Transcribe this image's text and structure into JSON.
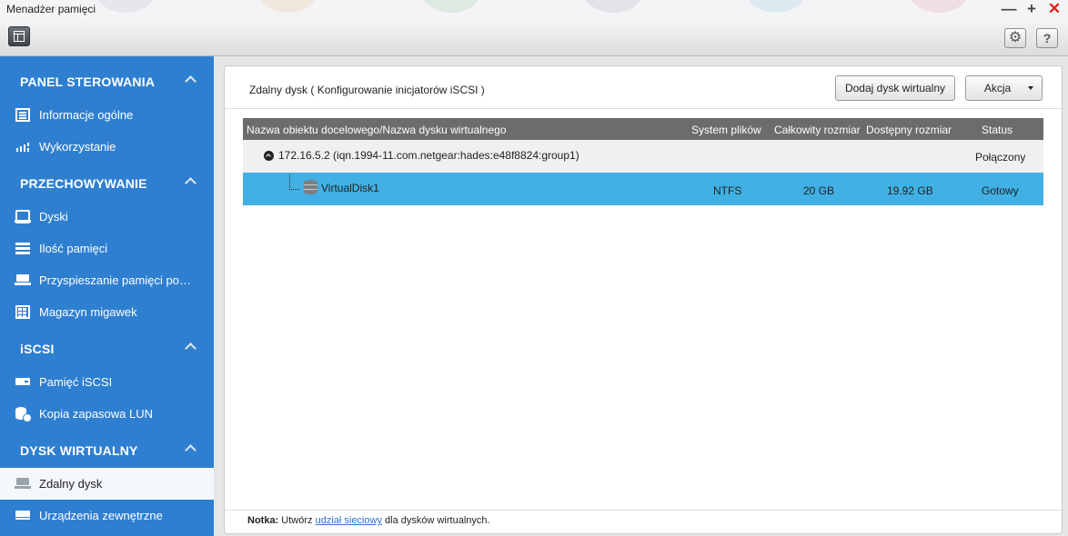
{
  "window": {
    "title": "Menadżer pamięci",
    "controls": {
      "minimize": "—",
      "maximize": "+",
      "close": "✕"
    }
  },
  "toolbar": {
    "layout_icon": "layout-icon",
    "settings_icon": "gear-icon",
    "help_label": "?"
  },
  "sidebar": {
    "sections": [
      {
        "title": "PANEL STEROWANIA",
        "items": [
          {
            "label": "Informacje ogólne",
            "icon": "info-list-icon"
          },
          {
            "label": "Wykorzystanie",
            "icon": "usage-bars-icon"
          }
        ]
      },
      {
        "title": "PRZECHOWYWANIE",
        "items": [
          {
            "label": "Dyski",
            "icon": "disk-icon"
          },
          {
            "label": "Ilość pamięci",
            "icon": "storage-stack-icon"
          },
          {
            "label": "Przyspieszanie pamięci podr…",
            "icon": "cache-drive-icon"
          },
          {
            "label": "Magazyn migawek",
            "icon": "snapshot-icon"
          }
        ]
      },
      {
        "title": "iSCSI",
        "items": [
          {
            "label": "Pamięć iSCSI",
            "icon": "iscsi-drive-icon"
          },
          {
            "label": "Kopia zapasowa LUN",
            "icon": "lun-backup-icon"
          }
        ]
      },
      {
        "title": "DYSK WIRTUALNY",
        "items": [
          {
            "label": "Zdalny dysk",
            "icon": "remote-disk-icon",
            "active": true
          },
          {
            "label": "Urządzenia zewnętrzne",
            "icon": "external-device-icon"
          }
        ]
      }
    ]
  },
  "main": {
    "title": "Zdalny dysk ( Konfigurowanie inicjatorów iSCSI )",
    "buttons": {
      "add_virtual_disk": "Dodaj dysk wirtualny",
      "action": "Akcja"
    },
    "table": {
      "columns": [
        "Nazwa obiektu docelowego/Nazwa dysku wirtualnego",
        "System plików",
        "Całkowity rozmiar",
        "Dostępny rozmiar",
        "Status"
      ],
      "target": {
        "name": "172.16.5.2 (iqn.1994-11.com.netgear:hades:e48f8824:group1)",
        "status": "Połączony"
      },
      "disk": {
        "name": "VirtualDisk1",
        "filesystem": "NTFS",
        "total": "20 GB",
        "available": "19.92 GB",
        "status": "Gotowy"
      }
    },
    "note": {
      "prefix": "Notka:",
      "before_link": " Utwórz ",
      "link": "udział sieciowy",
      "after_link": " dla dysków wirtualnych."
    }
  },
  "colors": {
    "sidebar_bg": "#2f7fd1",
    "selected_row": "#41b0e4",
    "table_header": "#6c6c6c",
    "close_button": "#e02020"
  }
}
